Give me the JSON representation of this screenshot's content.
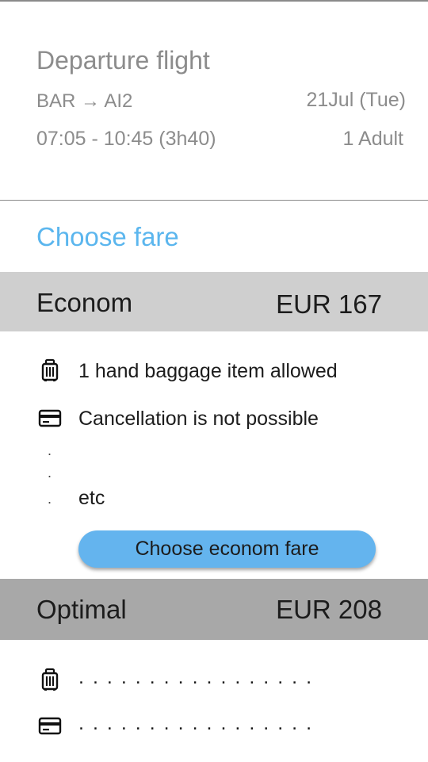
{
  "flight": {
    "title": "Departure flight",
    "route_from": "BAR",
    "route_arrow": "→",
    "route_to": "AI2",
    "date": "21Jul (Tue)",
    "times": "07:05 - 10:45 (3h40)",
    "passengers": "1 Adult"
  },
  "choose_fare_title": "Choose fare",
  "fares": [
    {
      "name": "Econom",
      "price": "EUR 167",
      "features": [
        {
          "icon": "luggage-icon",
          "text": "1 hand baggage item allowed"
        },
        {
          "icon": "credit-card-icon",
          "text": "Cancellation is not possible"
        }
      ],
      "ellipsis_dots": ".",
      "more": "etc",
      "button_label": "Choose econom fare"
    },
    {
      "name": "Optimal",
      "price": "EUR 208",
      "features": [
        {
          "icon": "luggage-icon",
          "text": "................."
        },
        {
          "icon": "credit-card-icon",
          "text": "................."
        }
      ]
    }
  ],
  "colors": {
    "accent": "#5bb6ee",
    "button": "#64b4ee",
    "econom_header": "#cfcfcf",
    "optimal_header": "#a8a8a8",
    "muted_text": "#8c8c8c"
  }
}
